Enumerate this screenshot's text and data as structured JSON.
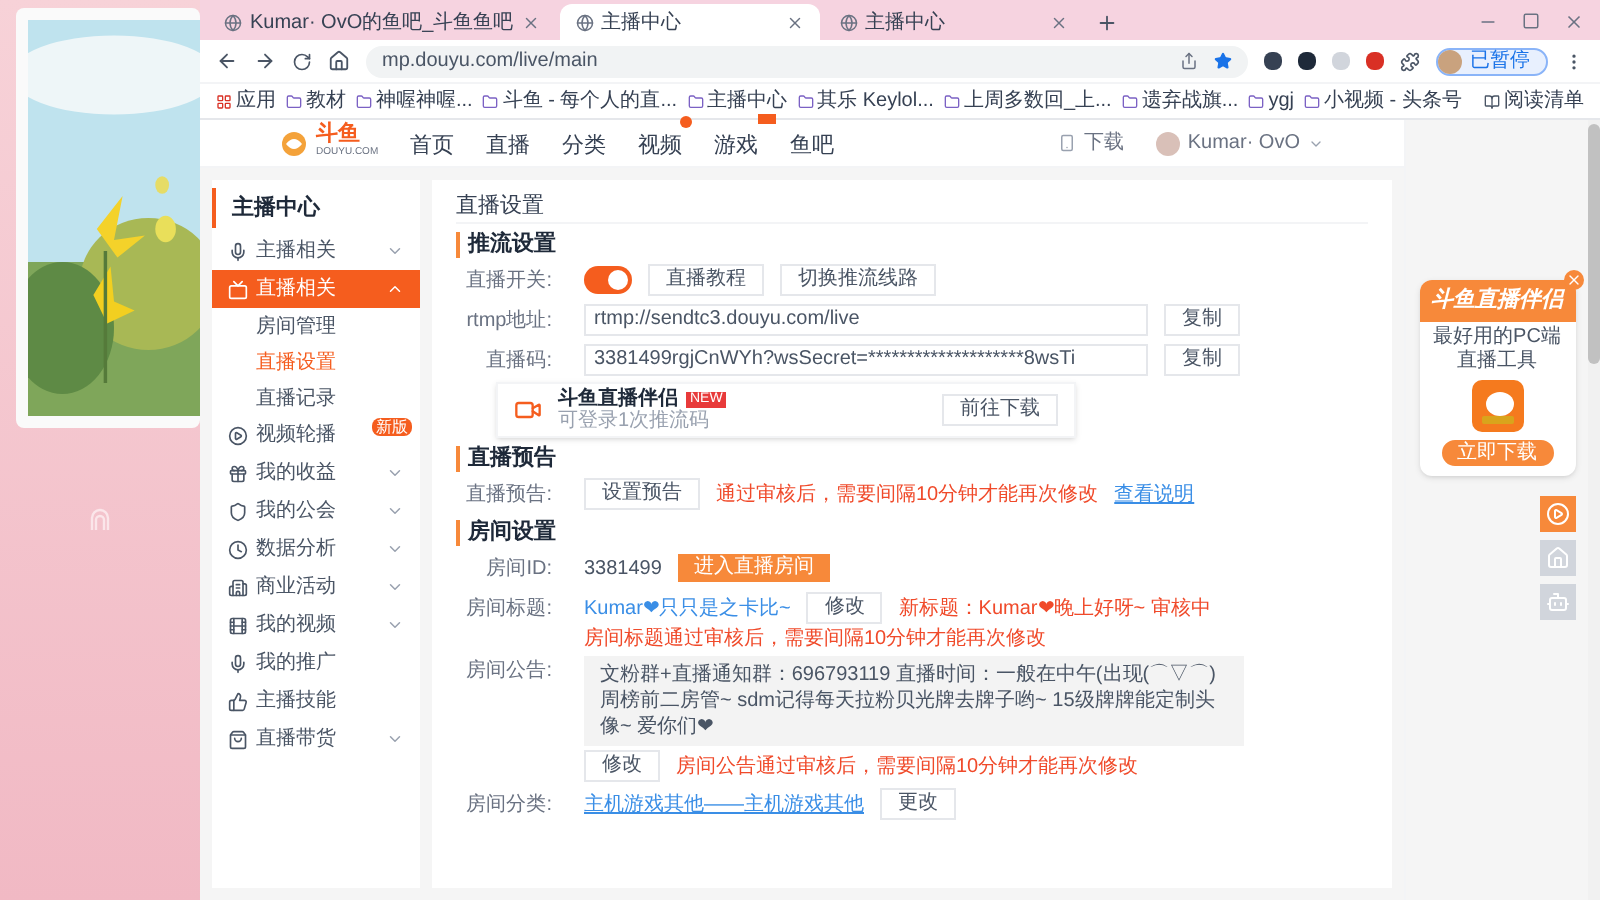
{
  "browser": {
    "tabs": [
      {
        "title": "Kumar· OvO的鱼吧_斗鱼鱼吧",
        "selected": false
      },
      {
        "title": "主播中心",
        "selected": true
      },
      {
        "title": "主播中心",
        "selected": false
      }
    ],
    "url": "mp.douyu.com/live/main",
    "profile_button": "已暂停",
    "bookmarks": [
      "应用",
      "教材",
      "神喔神喔...",
      "斗鱼 - 每个人的直...",
      "主播中心",
      "其乐 Keylol...",
      "上周多数回_上...",
      "遗弃战旗...",
      "ygj",
      "小视频 - 头条号"
    ],
    "reading_list": "阅读清单"
  },
  "site_header": {
    "logo": "斗鱼",
    "logo_sub": "DOUYU.COM",
    "nav": [
      {
        "label": "首页",
        "kind": "plain"
      },
      {
        "label": "直播",
        "kind": "plain"
      },
      {
        "label": "分类",
        "kind": "plain"
      },
      {
        "label": "视频",
        "kind": "dot"
      },
      {
        "label": "游戏",
        "kind": "tag"
      },
      {
        "label": "鱼吧",
        "kind": "plain"
      }
    ],
    "download": "下载",
    "username": "Kumar· OvO"
  },
  "sidebar": {
    "title": "主播中心",
    "items": [
      {
        "label": "主播相关",
        "expanded": false,
        "selected": false
      },
      {
        "label": "直播相关",
        "expanded": true,
        "selected": true,
        "children": [
          {
            "label": "房间管理",
            "selected": false
          },
          {
            "label": "直播设置",
            "selected": true
          },
          {
            "label": "直播记录",
            "selected": false
          }
        ]
      },
      {
        "label": "视频轮播",
        "selected": false,
        "badge": "新版"
      },
      {
        "label": "我的收益",
        "expanded": false,
        "selected": false
      },
      {
        "label": "我的公会",
        "expanded": false,
        "selected": false
      },
      {
        "label": "数据分析",
        "expanded": false,
        "selected": false
      },
      {
        "label": "商业活动",
        "expanded": false,
        "selected": false
      },
      {
        "label": "我的视频",
        "expanded": false,
        "selected": false
      },
      {
        "label": "我的推广",
        "selected": false
      },
      {
        "label": "主播技能",
        "selected": false
      },
      {
        "label": "直播带货",
        "expanded": false,
        "selected": false
      }
    ]
  },
  "main": {
    "title": "直播设置",
    "sections": [
      {
        "title": "推流设置",
        "rows": [
          {
            "kind": "switch",
            "label": "直播开关:",
            "on": true,
            "buttons": [
              "直播教程",
              "切换推流线路"
            ]
          },
          {
            "kind": "field",
            "label": "rtmp地址:",
            "value": "rtmp://sendtc3.douyu.com/live",
            "button": "复制"
          },
          {
            "kind": "field",
            "label": "直播码:",
            "value": "3381499rgjCnWYh?wsSecret=********************8wsTi",
            "button": "复制"
          },
          {
            "kind": "promo",
            "title": "斗鱼直播伴侣",
            "tag": "NEW",
            "subtitle": "可登录1次推流码",
            "button": "前往下载"
          }
        ]
      },
      {
        "title": "直播预告",
        "rows": [
          {
            "kind": "action",
            "label": "直播预告:",
            "button": "设置预告",
            "note": "通过审核后，需要间隔10分钟才能再次修改",
            "link": "查看说明"
          }
        ]
      },
      {
        "title": "房间设置",
        "rows": [
          {
            "kind": "id",
            "label": "房间ID:",
            "value": "3381499",
            "button": "进入直播房间"
          },
          {
            "kind": "title",
            "label": "房间标题:",
            "link": "Kumar❤只只是之卡比~",
            "button": "修改",
            "pending": "新标题：Kumar❤晚上好呀~  审核中",
            "note": "房间标题通过审核后，需要间隔10分钟才能再次修改"
          },
          {
            "kind": "textarea",
            "label": "房间公告:",
            "value": "文粉群+直播通知群：696793119 直播时间：一般在中午(出现(⌒▽⌒)周榜前二房管~ sdm记得每天拉粉贝光牌去牌子哟~ 15级牌牌能定制头像~ 爱你们❤",
            "button": "修改",
            "note": "房间公告通过审核后，需要间隔10分钟才能再次修改"
          },
          {
            "kind": "link",
            "label": "房间分类:",
            "link": "主机游戏其他——主机游戏其他",
            "button": "更改"
          }
        ]
      }
    ]
  },
  "ad": {
    "title": "斗鱼直播伴侣",
    "subtitle": "最好用的PC端直播工具",
    "button": "立即下载"
  }
}
